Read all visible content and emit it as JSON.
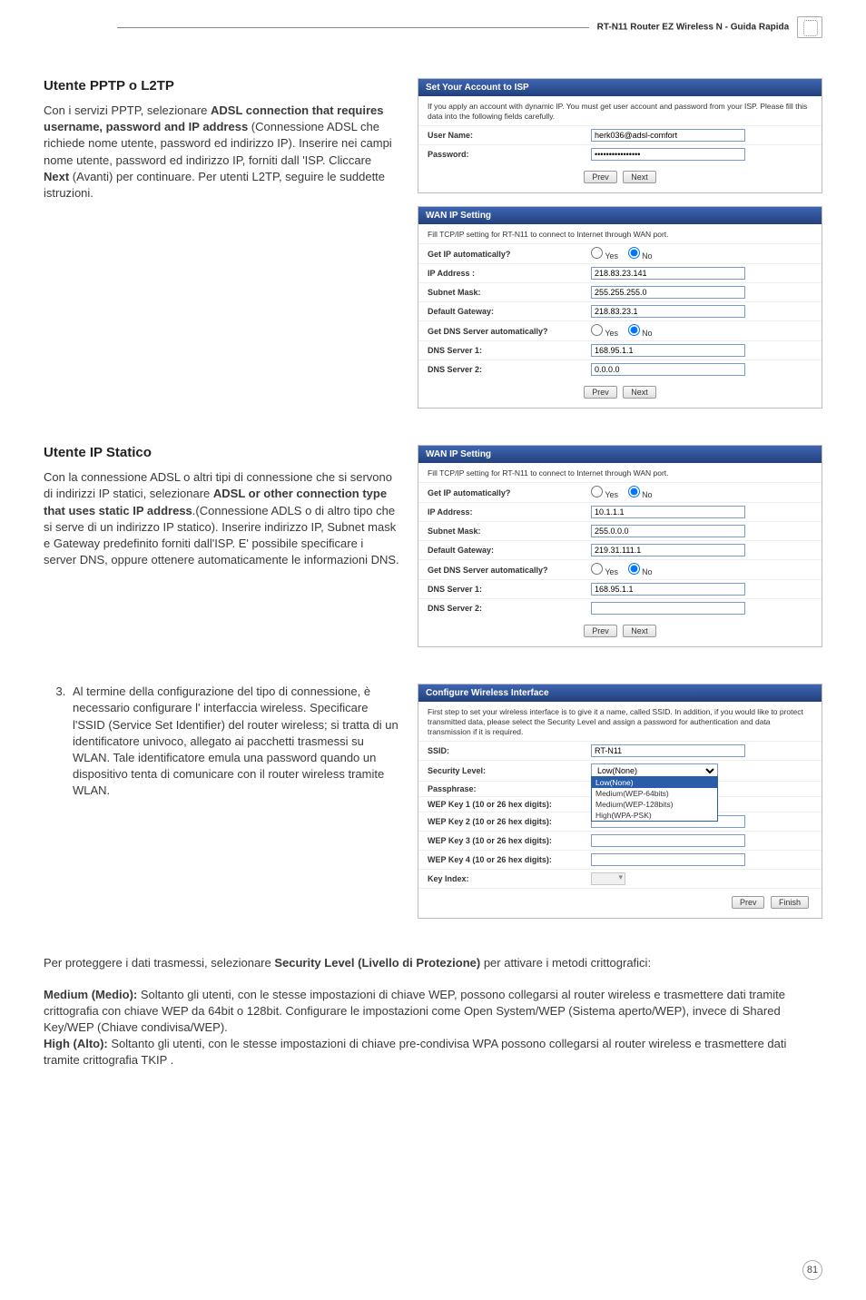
{
  "header": {
    "title": "RT-N11 Router EZ Wireless N - Guida Rapida"
  },
  "section1": {
    "heading": "Utente PPTP o L2TP",
    "body_pre1": "Con i servizi PPTP, selezionare ",
    "body_bold1": "ADSL connection that requires username, password and IP address",
    "body_post1": " (Connessione ADSL che richiede nome utente, password ed indirizzo IP). Inserire nei campi nome utente, password ed indirizzo IP, forniti dall 'ISP. Cliccare ",
    "body_bold2": "Next",
    "body_post2": " (Avanti) per continuare. Per utenti L2TP, seguire le suddette istruzioni."
  },
  "shotA": {
    "banner": "Set Your Account to ISP",
    "desc": "If you apply an account with dynamic IP. You must get user account and password from your ISP. Please fill this data into the following fields carefully.",
    "user_label": "User Name:",
    "user_value": "herk036@adsl-comfort",
    "pass_label": "Password:",
    "pass_value": "••••••••••••••••",
    "prev": "Prev",
    "next": "Next"
  },
  "shotB": {
    "banner": "WAN IP Setting",
    "desc": "Fill TCP/IP setting for RT-N11 to connect to Internet through WAN port.",
    "r1": "Get IP automatically?",
    "r1yes": "Yes",
    "r1no": "No",
    "r2": "IP Address :",
    "r2v": "218.83.23.141",
    "r3": "Subnet Mask:",
    "r3v": "255.255.255.0",
    "r4": "Default Gateway:",
    "r4v": "218.83.23.1",
    "r5": "Get DNS Server automatically?",
    "r5yes": "Yes",
    "r5no": "No",
    "r6": "DNS Server 1:",
    "r6v": "168.95.1.1",
    "r7": "DNS Server 2:",
    "r7v": "0.0.0.0",
    "prev": "Prev",
    "next": "Next"
  },
  "section2": {
    "heading": "Utente IP Statico",
    "body_pre1": "Con la connessione ADSL o altri tipi di connessione che si servono di indirizzi IP statici, selezionare ",
    "body_bold1": "ADSL or other connection type that uses static IP address",
    "body_post1": ".(Connessione ADLS o di altro tipo che si serve di un indirizzo IP statico). Inserire indirizzo IP, Subnet mask e Gateway predefinito forniti dall'ISP. E' possibile specificare i server DNS, oppure ottenere automaticamente le informazioni DNS."
  },
  "shotC": {
    "banner": "WAN IP Setting",
    "desc": "Fill TCP/IP setting for RT-N11 to connect to Internet through WAN port.",
    "r1": "Get IP automatically?",
    "r1yes": "Yes",
    "r1no": "No",
    "r2": "IP Address:",
    "r2v": "10.1.1.1",
    "r3": "Subnet Mask:",
    "r3v": "255.0.0.0",
    "r4": "Default Gateway:",
    "r4v": "219.31.111.1",
    "r5": "Get DNS Server automatically?",
    "r5yes": "Yes",
    "r5no": "No",
    "r6": "DNS Server 1:",
    "r6v": "168.95.1.1",
    "r7": "DNS Server 2:",
    "r7v": "",
    "prev": "Prev",
    "next": "Next"
  },
  "list3": {
    "text": "Al termine della configurazione del tipo di connessione, è necessario configurare l' interfaccia wireless. Specificare l'SSID (Service Set Identifier) del router wireless; si tratta di un identificatore univoco, allegato ai pacchetti trasmessi su WLAN. Tale identificatore emula una password quando un dispositivo tenta di comunicare con il router wireless tramite WLAN."
  },
  "shotD": {
    "banner": "Configure Wireless Interface",
    "desc": "First step to set your wireless interface is to give it a name, called SSID. In addition, if you would like to protect transmitted data, please select the Security Level and assign a password for authentication and data transmission if it is required.",
    "r1": "SSID:",
    "r1v": "RT-N11",
    "r2": "Security Level:",
    "r2v": "Low(None)",
    "dd0": "Low(None)",
    "dd1": "Medium(WEP-64bits)",
    "dd2": "Medium(WEP-128bits)",
    "dd3": "High(WPA-PSK)",
    "r3": "Passphrase:",
    "r4": "WEP Key 1 (10 or 26 hex digits):",
    "r5": "WEP Key 2 (10 or 26 hex digits):",
    "r6": "WEP Key 3 (10 or 26 hex digits):",
    "r7": "WEP Key 4 (10 or 26 hex digits):",
    "r8": "Key Index:",
    "prev": "Prev",
    "finish": "Finish"
  },
  "para1": {
    "pre": "Per proteggere i dati trasmessi, selezionare ",
    "bold": "Security Level (Livello di Protezione)",
    "post": " per attivare i metodi crittografici:"
  },
  "para2": {
    "bold": "Medium (Medio):",
    "text": " Soltanto gli utenti, con le stesse impostazioni di chiave WEP, possono collegarsi al router wireless e trasmettere dati tramite crittografia con chiave WEP da 64bit o 128bit. Configurare le impostazioni come Open System/WEP (Sistema aperto/WEP), invece di Shared Key/WEP (Chiave condivisa/WEP)."
  },
  "para3": {
    "bold": "High (Alto):",
    "text": " Soltanto gli utenti, con le stesse impostazioni di chiave pre-condivisa WPA possono collegarsi al router wireless e trasmettere dati tramite crittografia TKIP ."
  },
  "pageno": "81"
}
